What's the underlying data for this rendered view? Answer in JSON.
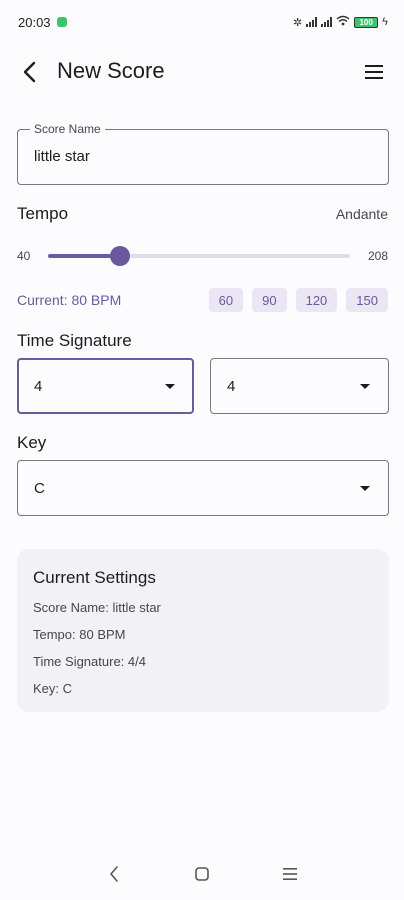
{
  "status": {
    "time": "20:03",
    "battery": "100"
  },
  "appbar": {
    "title": "New Score"
  },
  "score_name": {
    "label": "Score Name",
    "value": "little star"
  },
  "tempo": {
    "label": "Tempo",
    "marking": "Andante",
    "min": "40",
    "max": "208",
    "bpm": 80,
    "current_text": "Current: 80 BPM",
    "presets": [
      "60",
      "90",
      "120",
      "150"
    ]
  },
  "time_signature": {
    "label": "Time Signature",
    "numerator": "4",
    "denominator": "4"
  },
  "key": {
    "label": "Key",
    "value": "C"
  },
  "current_settings": {
    "title": "Current Settings",
    "score_name": "Score Name: little star",
    "tempo": "Tempo: 80 BPM",
    "time_signature": "Time Signature: 4/4",
    "key": "Key: C"
  },
  "colors": {
    "accent": "#6a5a9d",
    "background": "#fcfbfe",
    "card": "#f2f1f4"
  }
}
